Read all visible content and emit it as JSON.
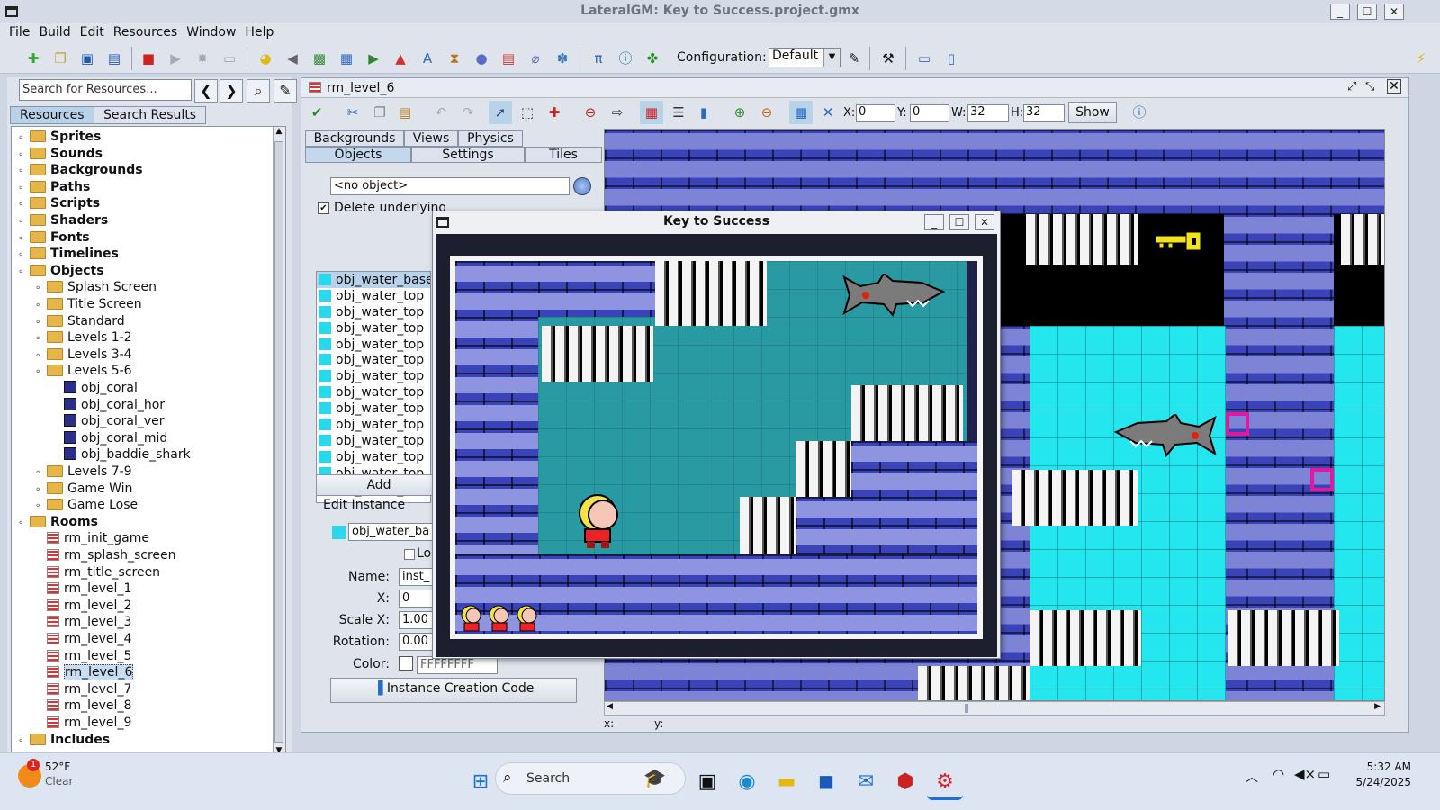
{
  "window": {
    "title": "LateralGM: Key to Success.project.gmx",
    "min": "_",
    "max": "☐",
    "close": "✕"
  },
  "menu": [
    "File",
    "Build",
    "Edit",
    "Resources",
    "Window",
    "Help"
  ],
  "toolbar": {
    "config_label": "Configuration:",
    "config_value": "Default"
  },
  "left": {
    "search_placeholder": "Search for Resources...",
    "tabs": [
      "Resources",
      "Search Results"
    ],
    "tree": [
      {
        "label": "Sprites",
        "lvl": 0,
        "type": "folder",
        "bold": true
      },
      {
        "label": "Sounds",
        "lvl": 0,
        "type": "folder",
        "bold": true
      },
      {
        "label": "Backgrounds",
        "lvl": 0,
        "type": "folder",
        "bold": true
      },
      {
        "label": "Paths",
        "lvl": 0,
        "type": "folder",
        "bold": true
      },
      {
        "label": "Scripts",
        "lvl": 0,
        "type": "folder",
        "bold": true
      },
      {
        "label": "Shaders",
        "lvl": 0,
        "type": "folder",
        "bold": true
      },
      {
        "label": "Fonts",
        "lvl": 0,
        "type": "folder",
        "bold": true
      },
      {
        "label": "Timelines",
        "lvl": 0,
        "type": "folder",
        "bold": true
      },
      {
        "label": "Objects",
        "lvl": 0,
        "type": "folder",
        "bold": true
      },
      {
        "label": "Splash Screen",
        "lvl": 1,
        "type": "folder"
      },
      {
        "label": "Title Screen",
        "lvl": 1,
        "type": "folder"
      },
      {
        "label": "Standard",
        "lvl": 1,
        "type": "folder"
      },
      {
        "label": "Levels 1-2",
        "lvl": 1,
        "type": "folder"
      },
      {
        "label": "Levels 3-4",
        "lvl": 1,
        "type": "folder"
      },
      {
        "label": "Levels 5-6",
        "lvl": 1,
        "type": "folder"
      },
      {
        "label": "obj_coral",
        "lvl": 2,
        "type": "obj"
      },
      {
        "label": "obj_coral_hor",
        "lvl": 2,
        "type": "obj"
      },
      {
        "label": "obj_coral_ver",
        "lvl": 2,
        "type": "obj"
      },
      {
        "label": "obj_coral_mid",
        "lvl": 2,
        "type": "obj"
      },
      {
        "label": "obj_baddie_shark",
        "lvl": 2,
        "type": "obj"
      },
      {
        "label": "Levels 7-9",
        "lvl": 1,
        "type": "folder"
      },
      {
        "label": "Game Win",
        "lvl": 1,
        "type": "folder"
      },
      {
        "label": "Game Lose",
        "lvl": 1,
        "type": "folder"
      },
      {
        "label": "Rooms",
        "lvl": 0,
        "type": "folder",
        "bold": true
      },
      {
        "label": "rm_init_game",
        "lvl": 1,
        "type": "room"
      },
      {
        "label": "rm_splash_screen",
        "lvl": 1,
        "type": "room"
      },
      {
        "label": "rm_title_screen",
        "lvl": 1,
        "type": "room"
      },
      {
        "label": "rm_level_1",
        "lvl": 1,
        "type": "room"
      },
      {
        "label": "rm_level_2",
        "lvl": 1,
        "type": "room"
      },
      {
        "label": "rm_level_3",
        "lvl": 1,
        "type": "room"
      },
      {
        "label": "rm_level_4",
        "lvl": 1,
        "type": "room"
      },
      {
        "label": "rm_level_5",
        "lvl": 1,
        "type": "room"
      },
      {
        "label": "rm_level_6",
        "lvl": 1,
        "type": "room",
        "selected": true
      },
      {
        "label": "rm_level_7",
        "lvl": 1,
        "type": "room"
      },
      {
        "label": "rm_level_8",
        "lvl": 1,
        "type": "room"
      },
      {
        "label": "rm_level_9",
        "lvl": 1,
        "type": "room"
      },
      {
        "label": "Includes",
        "lvl": 0,
        "type": "folder",
        "bold": true
      }
    ]
  },
  "room": {
    "title": "rm_level_6",
    "fields": {
      "x_label": "X:",
      "x": "0",
      "y_label": "Y:",
      "y": "0",
      "w_label": "W:",
      "w": "32",
      "h_label": "H:",
      "h": "32",
      "show": "Show"
    },
    "tabs_row1": [
      "Backgrounds",
      "Views",
      "Physics"
    ],
    "tabs_row2": [
      "Objects",
      "Settings",
      "Tiles"
    ],
    "object_select": "<no object>",
    "delete_underlying": "Delete underlying",
    "objects": [
      "obj_water_base",
      "obj_water_top",
      "obj_water_top",
      "obj_water_top",
      "obj_water_top",
      "obj_water_top",
      "obj_water_top",
      "obj_water_top",
      "obj_water_top",
      "obj_water_top",
      "obj_water_top",
      "obj_water_top",
      "obj_water_top",
      "obj_water_top"
    ],
    "add": "Add",
    "edit_instance": "Edit Instance",
    "instance_object": "obj_water_ba",
    "lock": "Lo",
    "name_label": "Name:",
    "name": "inst_",
    "x_label": "X:",
    "x": "0",
    "scalex_label": "Scale X:",
    "scalex": "1.00",
    "rotation_label": "Rotation:",
    "rotation": "0.00",
    "color_label": "Color:",
    "color": "FFFFFFFF",
    "creation_code": "Instance Creation Code",
    "status_x": "x:",
    "status_y": "y:"
  },
  "game": {
    "title": "Key to Success"
  },
  "taskbar": {
    "temp": "52°F",
    "cond": "Clear",
    "badge": "1",
    "search": "Search",
    "time": "5:32 AM",
    "date": "5/24/2025"
  }
}
